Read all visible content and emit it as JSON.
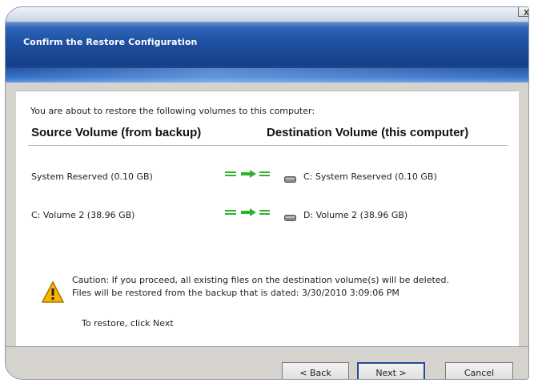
{
  "window": {
    "title": "Confirm the Restore Configuration",
    "close_glyph": "x"
  },
  "content": {
    "intro": "You are about to restore the following volumes to this computer:",
    "source_header": "Source Volume (from backup)",
    "destination_header": "Destination Volume (this computer)",
    "rows": [
      {
        "source": "System Reserved (0.10 GB)",
        "destination": "C: System Reserved (0.10 GB)"
      },
      {
        "source": "C: Volume 2 (38.96 GB)",
        "destination": "D: Volume 2 (38.96 GB)"
      }
    ],
    "caution_line1": "Caution: If you proceed, all existing files on the destination volume(s) will be deleted.",
    "caution_line2": "Files will be restored from the backup that is dated: 3/30/2010 3:09:06 PM",
    "restore_hint": "To restore, click Next"
  },
  "buttons": {
    "back": "< Back",
    "next": "Next >",
    "cancel": "Cancel"
  },
  "icons": {
    "mapping_arrow": "green-arrow-icon",
    "drive": "hard-drive-icon",
    "warning": "warning-icon"
  },
  "colors": {
    "arrow_green": "#2fb12f",
    "title_blue": "#1e4f9f",
    "warning_yellow": "#f7b500"
  }
}
